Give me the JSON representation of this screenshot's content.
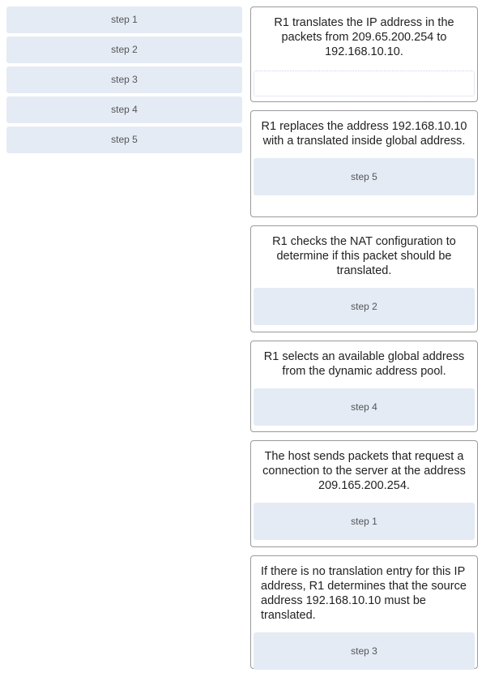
{
  "options": [
    {
      "label": "step 1"
    },
    {
      "label": "step 2"
    },
    {
      "label": "step 3"
    },
    {
      "label": "step 4"
    },
    {
      "label": "step 5"
    }
  ],
  "targets": [
    {
      "text": "R1 translates the IP address in the packets from 209.65.200.254 to 192.168.10.10.",
      "answer": ""
    },
    {
      "text": "R1 replaces the address 192.168.10.10 with a translated inside global address.",
      "answer": "step 5"
    },
    {
      "text": "R1 checks the NAT configuration to determine if this packet should be translated.",
      "answer": "step 2"
    },
    {
      "text": "R1 selects an available global address from the dynamic address pool.",
      "answer": "step 4"
    },
    {
      "text": "The host sends packets that request a connection to the server at the address 209.165.200.254.",
      "answer": "step 1"
    },
    {
      "text": "If there is no translation entry for this IP address, R1 determines that the source address 192.168.10.10 must be translated.",
      "answer": "step 3"
    }
  ]
}
